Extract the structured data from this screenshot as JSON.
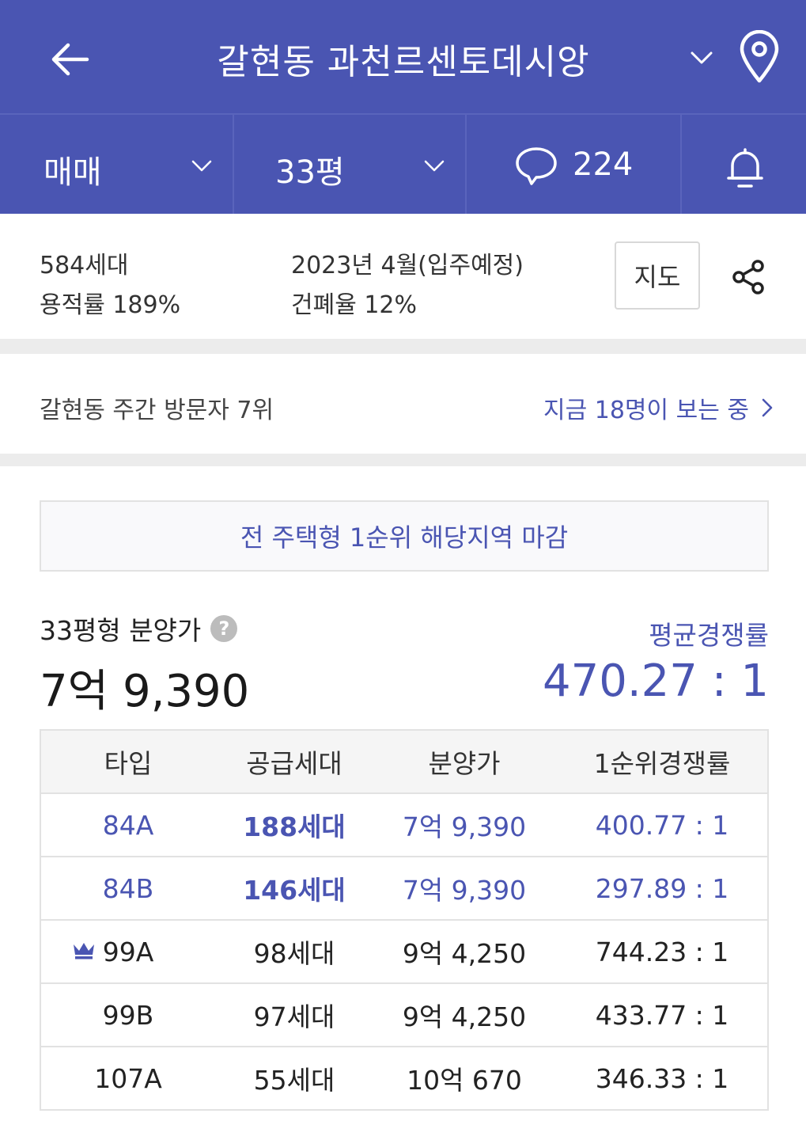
{
  "header": {
    "title": "갈현동 과천르센토데시앙"
  },
  "filters": {
    "trade_type": "매매",
    "size": "33평",
    "comment_count": "224"
  },
  "summary": {
    "households": "584세대",
    "move_in": "2023년 4월(입주예정)",
    "floor_area_ratio": "용적률 189%",
    "building_coverage": "건폐율 12%",
    "map_button": "지도"
  },
  "visitors": {
    "rank_text": "갈현동 주간 방문자 7위",
    "now_viewing": "지금 18명이 보는 중"
  },
  "notice": "전 주택형 1순위 해당지역 마감",
  "price": {
    "label": "33평형 분양가",
    "help": "?",
    "value": "7억 9,390",
    "avg_comp_label": "평균경쟁률",
    "avg_comp_value": "470.27 : 1"
  },
  "table": {
    "headers": [
      "타입",
      "공급세대",
      "분양가",
      "1순위경쟁률"
    ],
    "rows": [
      {
        "type": "84A",
        "households": "188세대",
        "price": "7억 9,390",
        "ratio": "400.77 : 1",
        "highlight": true
      },
      {
        "type": "84B",
        "households": "146세대",
        "price": "7억 9,390",
        "ratio": "297.89 : 1",
        "highlight": true
      },
      {
        "type": "99A",
        "households": "98세대",
        "price": "9억 4,250",
        "ratio": "744.23 : 1",
        "crown": true
      },
      {
        "type": "99B",
        "households": "97세대",
        "price": "9억 4,250",
        "ratio": "433.77 : 1"
      },
      {
        "type": "107A",
        "households": "55세대",
        "price": "10억 670",
        "ratio": "346.33 : 1"
      }
    ]
  },
  "colors": {
    "brand": "#4a55b2",
    "divider": "#ececec"
  }
}
